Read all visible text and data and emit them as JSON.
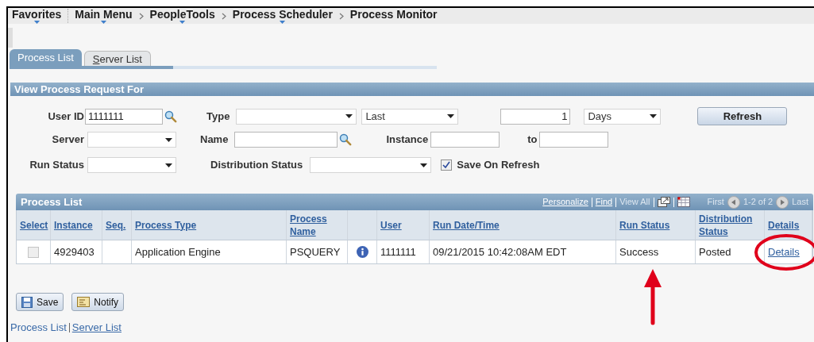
{
  "breadcrumbs": [
    {
      "label": "Favorites",
      "menu": true
    },
    {
      "label": "Main Menu",
      "menu": true
    },
    {
      "label": "PeopleTools",
      "menu": true
    },
    {
      "label": "Process Scheduler",
      "menu": true
    },
    {
      "label": "Process Monitor",
      "menu": false
    }
  ],
  "tabs": [
    {
      "label": "Process List",
      "selected": true
    },
    {
      "label": "Server List",
      "selected": false
    }
  ],
  "filter_panel": {
    "title": "View Process Request For",
    "rows": [
      [
        {
          "kind": "label",
          "text": "User ID"
        },
        {
          "kind": "lookup",
          "value": "1111111"
        },
        {
          "kind": "label",
          "text": "Type"
        },
        {
          "kind": "select"
        },
        {
          "kind": "select",
          "value": "Last"
        },
        {
          "kind": "number",
          "value": "1"
        },
        {
          "kind": "select",
          "value": "Days"
        },
        {
          "kind": "button",
          "text": "Refresh"
        }
      ],
      [
        {
          "kind": "label",
          "text": "Server"
        },
        {
          "kind": "select"
        },
        {
          "kind": "label",
          "text": "Name"
        },
        {
          "kind": "lookup"
        },
        {
          "kind": "label",
          "text": "Instance"
        },
        {
          "kind": "text"
        },
        {
          "kind": "label",
          "text": "to"
        },
        {
          "kind": "text"
        }
      ],
      [
        {
          "kind": "label",
          "text": "Run Status"
        },
        {
          "kind": "select"
        },
        {
          "kind": "label",
          "text": "Distribution Status"
        },
        {
          "kind": "select"
        },
        {
          "kind": "checkbox",
          "text": "Save On Refresh",
          "checked": true
        }
      ]
    ]
  },
  "process_list": {
    "title": "Process List",
    "toolbar": [
      {
        "kind": "link",
        "label": "Personalize",
        "disabled": false
      },
      {
        "kind": "link",
        "label": "Find",
        "disabled": false
      },
      {
        "kind": "link",
        "label": "View All",
        "disabled": true
      },
      {
        "kind": "zoom"
      },
      {
        "kind": "download"
      },
      {
        "kind": "link",
        "label": "First",
        "disabled": true
      },
      {
        "kind": "prev"
      },
      {
        "kind": "range",
        "label": "1-2 of 2"
      },
      {
        "kind": "next"
      },
      {
        "kind": "link",
        "label": "Last",
        "disabled": true
      }
    ],
    "columns": [
      {
        "label": "Select"
      },
      {
        "label": "Instance"
      },
      {
        "label": "Seq."
      },
      {
        "label": "Process Type"
      },
      {
        "label": "Process Name"
      },
      {},
      {
        "label": "User"
      },
      {
        "label": "Run Date/Time"
      },
      {
        "label": "Run Status"
      },
      {
        "label": "Distribution Status"
      },
      {
        "label": "Details"
      }
    ],
    "rows": [
      {
        "cells": [
          {
            "kind": "checkbox",
            "checked": false
          },
          {
            "kind": "text",
            "text": "4929403"
          },
          {
            "kind": "empty"
          },
          {
            "kind": "text",
            "text": "Application Engine"
          },
          {
            "kind": "text",
            "text": "PSQUERY"
          },
          {
            "kind": "info"
          },
          {
            "kind": "text",
            "text": "1111111"
          },
          {
            "kind": "text",
            "text": "09/21/2015 10:42:08AM EDT"
          },
          {
            "kind": "text",
            "text": "Success"
          },
          {
            "kind": "text",
            "text": "Posted"
          },
          {
            "kind": "link",
            "text": "Details"
          }
        ]
      }
    ]
  },
  "buttons": [
    {
      "label": "Save",
      "kind": "save"
    },
    {
      "label": "Notify",
      "kind": "notify"
    }
  ],
  "footer_links": [
    {
      "label": "Process List",
      "selected": true
    },
    {
      "label": "Server List",
      "selected": false
    }
  ]
}
